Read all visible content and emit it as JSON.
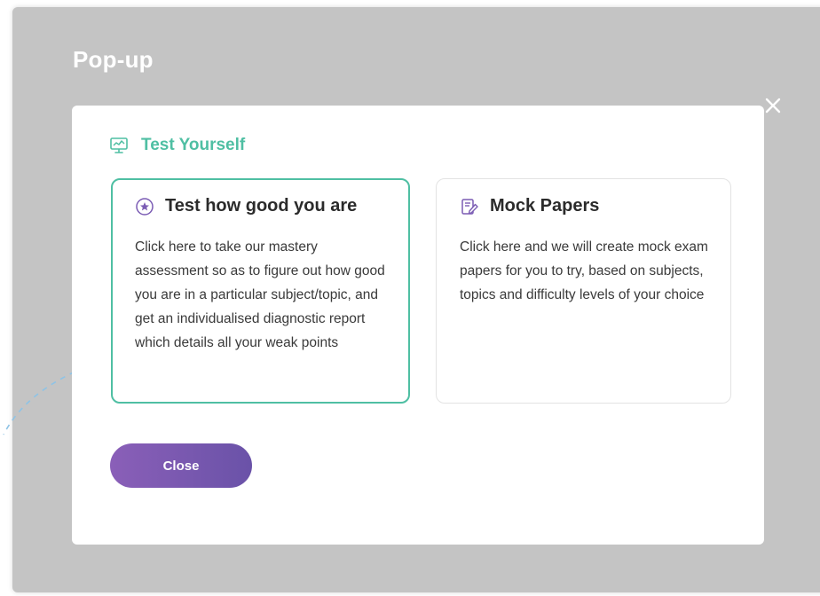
{
  "page": {
    "title": "Pop-up"
  },
  "modal": {
    "close_icon": "close-icon",
    "header": {
      "icon": "chart-monitor-icon",
      "title": "Test Yourself"
    },
    "cards": [
      {
        "icon": "star-circle-icon",
        "title": "Test how good you are",
        "description": "Click here to take our mastery assessment so as to figure out how good you are in a particular subject/topic, and get an individualised diagnostic report which details all your weak points",
        "selected": true
      },
      {
        "icon": "edit-document-icon",
        "title": "Mock Papers",
        "description": "Click here and we will create mock exam papers for you to try, based on subjects, topics and difficulty levels of your choice",
        "selected": false
      }
    ],
    "close_button_label": "Close"
  },
  "colors": {
    "backdrop": "#c4c4c4",
    "accent_teal": "#4fbfa3",
    "accent_purple": "#7b5cb4",
    "card_border": "#e3e3e3",
    "text_dark": "#2b2b2b"
  }
}
